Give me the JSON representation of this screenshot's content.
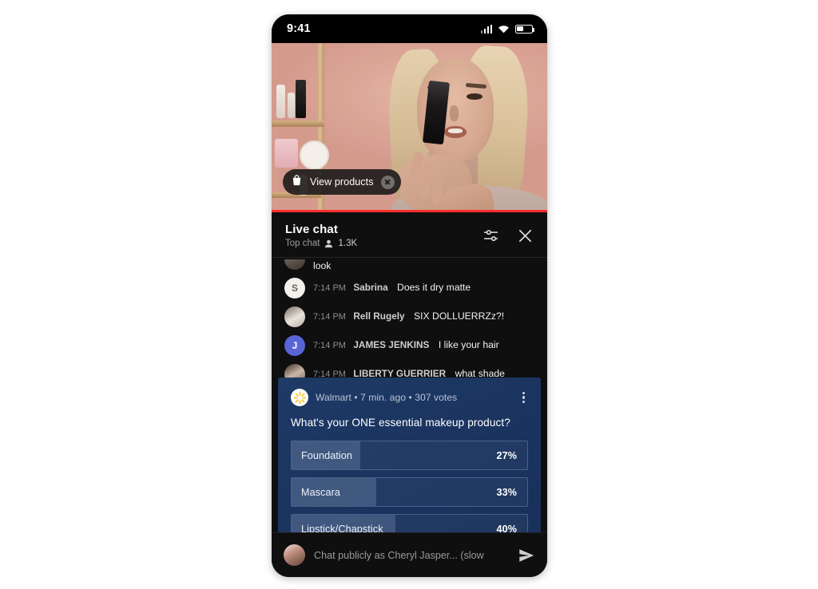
{
  "status_bar": {
    "time": "9:41",
    "icons": [
      "signal-bars-icon",
      "wifi-icon",
      "battery-icon"
    ]
  },
  "video": {
    "overlay_pill": {
      "icon": "shopping-bag-icon",
      "label": "View products",
      "close_icon": "close-icon"
    },
    "progress_color": "#ff2d2d"
  },
  "chat_header": {
    "title": "Live chat",
    "subtitle": "Top chat",
    "viewer_icon": "person-icon",
    "viewer_count": "1.3K",
    "tune_icon": "tune-icon",
    "close_icon": "close-icon"
  },
  "messages": [
    {
      "avatar_kind": "av-cup",
      "avatar_initial": "",
      "time": "",
      "name": "",
      "text": "look"
    },
    {
      "avatar_kind": "av-s",
      "avatar_initial": "S",
      "time": "7:14 PM",
      "name": "Sabrina",
      "text": "Does it dry matte"
    },
    {
      "avatar_kind": "av-photo1",
      "avatar_initial": "",
      "time": "7:14 PM",
      "name": "Rell Rugely",
      "text": "SIX DOLLUERRZz?!"
    },
    {
      "avatar_kind": "av-j",
      "avatar_initial": "J",
      "time": "7:14 PM",
      "name": "JAMES JENKINS",
      "text": "I like your hair"
    },
    {
      "avatar_kind": "av-photo2",
      "avatar_initial": "",
      "time": "7:14 PM",
      "name": "LIBERTY GUERRIER",
      "text": "what shade is the concealer?"
    }
  ],
  "poll": {
    "brand_logo": "walmart-spark-icon",
    "meta": "Walmart • 7 min. ago • 307 votes",
    "brand": "Walmart",
    "age": "7 min. ago",
    "votes": "307 votes",
    "question": "What's your ONE essential makeup product?",
    "menu_icon": "kebab-menu-icon",
    "options": [
      {
        "label": "Foundation",
        "percent_label": "27%",
        "percent": 29
      },
      {
        "label": "Mascara",
        "percent_label": "33%",
        "percent": 36
      },
      {
        "label": "Lipstick/Chapstick",
        "percent_label": "40%",
        "percent": 44
      }
    ]
  },
  "chat_input": {
    "avatar": "user-avatar",
    "placeholder": "Chat publicly as Cheryl Jasper... (slow",
    "send_icon": "send-icon"
  }
}
